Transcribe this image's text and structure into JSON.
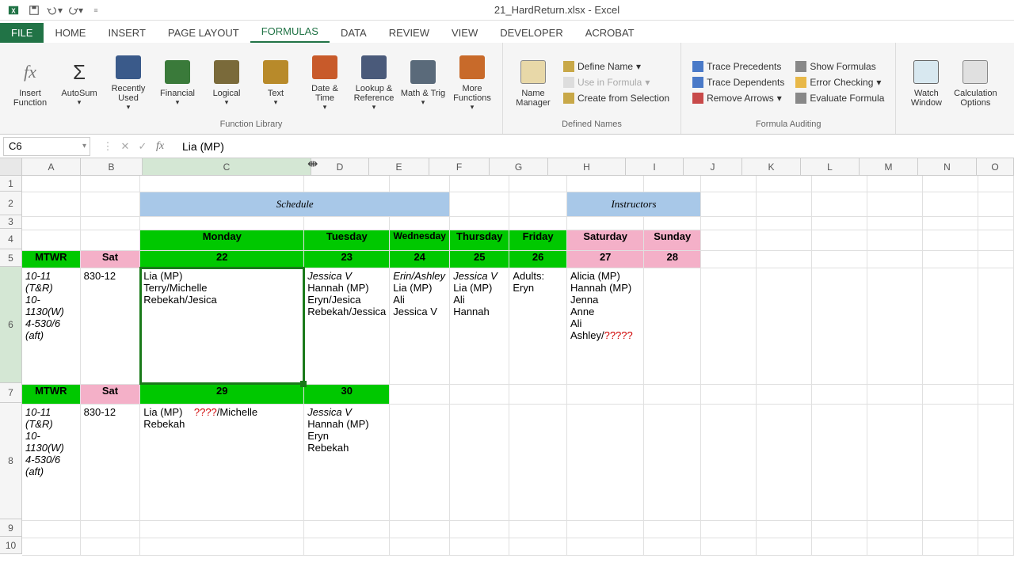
{
  "title": "21_HardReturn.xlsx - Excel",
  "tabs": [
    "FILE",
    "HOME",
    "INSERT",
    "PAGE LAYOUT",
    "FORMULAS",
    "DATA",
    "REVIEW",
    "VIEW",
    "DEVELOPER",
    "ACROBAT"
  ],
  "active_tab": "FORMULAS",
  "ribbon": {
    "lib": {
      "label": "Function Library",
      "insert_function": "Insert Function",
      "autosum": "AutoSum",
      "recently": "Recently Used",
      "financial": "Financial",
      "logical": "Logical",
      "text": "Text",
      "datetime": "Date & Time",
      "lookup": "Lookup & Reference",
      "math": "Math & Trig",
      "more": "More Functions"
    },
    "names": {
      "label": "Defined Names",
      "manager": "Name Manager",
      "define": "Define Name",
      "use": "Use in Formula",
      "create": "Create from Selection"
    },
    "audit": {
      "label": "Formula Auditing",
      "precedents": "Trace Precedents",
      "dependents": "Trace Dependents",
      "remove": "Remove Arrows",
      "show": "Show Formulas",
      "error": "Error Checking",
      "eval": "Evaluate Formula"
    },
    "watch": "Watch Window",
    "calc": "Calculation Options"
  },
  "name_box": "C6",
  "formula": "Lia (MP)",
  "columns": [
    "A",
    "B",
    "C",
    "D",
    "E",
    "F",
    "G",
    "H",
    "I",
    "J",
    "K",
    "L",
    "M",
    "N",
    "O"
  ],
  "rows": [
    "1",
    "2",
    "3",
    "4",
    "5",
    "6",
    "7",
    "8",
    "9",
    "10"
  ],
  "cells": {
    "e2": "Schedule",
    "i2": "Instructors",
    "c4": "Monday",
    "d4": "Tuesday",
    "e4": "Wednesday",
    "f4": "Thursday",
    "g4": "Friday",
    "h4": "Saturday",
    "i4": "Sunday",
    "a5": "MTWR",
    "b5": "Sat",
    "c5": "22",
    "d5": "23",
    "e5": "24",
    "f5": "25",
    "g5": "26",
    "h5": "27",
    "i5": "28",
    "a6": "10-11 (T&R)\n10-1130(W)\n4-530/6 (aft)",
    "b6": "830-12",
    "c6": "Lia (MP)\nTerry/Michelle\nRebekah/Jesica",
    "d6_i": "Jessica V",
    "d6_r": "\nHannah (MP)\nEryn/Jesica\nRebekah/Jessica",
    "e6_i": "Erin/Ashley",
    "e6_r": "\nLia (MP)\nAli\nJessica V",
    "f6_i": "Jessica V",
    "f6_r": "\nLia (MP)\nAli\nHannah",
    "g6": "Adults: Eryn",
    "h6": "Alicia (MP)\nHannah (MP) Jenna\nAnne\nAli\nAshley/",
    "h6_red": "?????",
    "a7": "MTWR",
    "b7": "Sat",
    "c7": "29",
    "d7": "30",
    "a8": "10-11 (T&R)\n10-1130(W)\n4-530/6 (aft)",
    "b8": "830-12",
    "c8_a": "Lia (MP)    ",
    "c8_red": "????",
    "c8_b": "/Michelle\nRebekah",
    "d8_i": "Jessica V",
    "d8_r": "\nHannah (MP)\nEryn\nRebekah"
  },
  "chart_data": {
    "type": "table",
    "title": "Schedule",
    "columns": [
      "Monday",
      "Tuesday",
      "Wednesday",
      "Thursday",
      "Friday",
      "Saturday",
      "Sunday"
    ],
    "dates_row": [
      22,
      23,
      24,
      25,
      26,
      27,
      28
    ],
    "week1": {
      "time_label": "10-11 (T&R) / 10-1130(W) / 4-530/6 (aft)",
      "sat_label": "830-12",
      "Monday": [
        "Lia (MP)",
        "Terry/Michelle",
        "Rebekah/Jesica"
      ],
      "Tuesday": [
        "Jessica V",
        "Hannah (MP)",
        "Eryn/Jesica",
        "Rebekah/Jessica"
      ],
      "Wednesday": [
        "Erin/Ashley",
        "Lia (MP)",
        "Ali",
        "Jessica V"
      ],
      "Thursday": [
        "Jessica V",
        "Lia (MP)",
        "Ali",
        "Hannah"
      ],
      "Friday": [
        "Adults: Eryn"
      ],
      "Saturday": [
        "Alicia (MP)",
        "Hannah (MP) Jenna",
        "Anne",
        "Ali",
        "Ashley/?????"
      ]
    },
    "dates_row2": [
      29,
      30
    ],
    "week2": {
      "time_label": "10-11 (T&R) / 10-1130(W) / 4-530/6 (aft)",
      "sat_label": "830-12",
      "Monday": [
        "Lia (MP)",
        "????/Michelle",
        "Rebekah"
      ],
      "Tuesday": [
        "Jessica V",
        "Hannah (MP)",
        "Eryn",
        "Rebekah"
      ]
    }
  }
}
